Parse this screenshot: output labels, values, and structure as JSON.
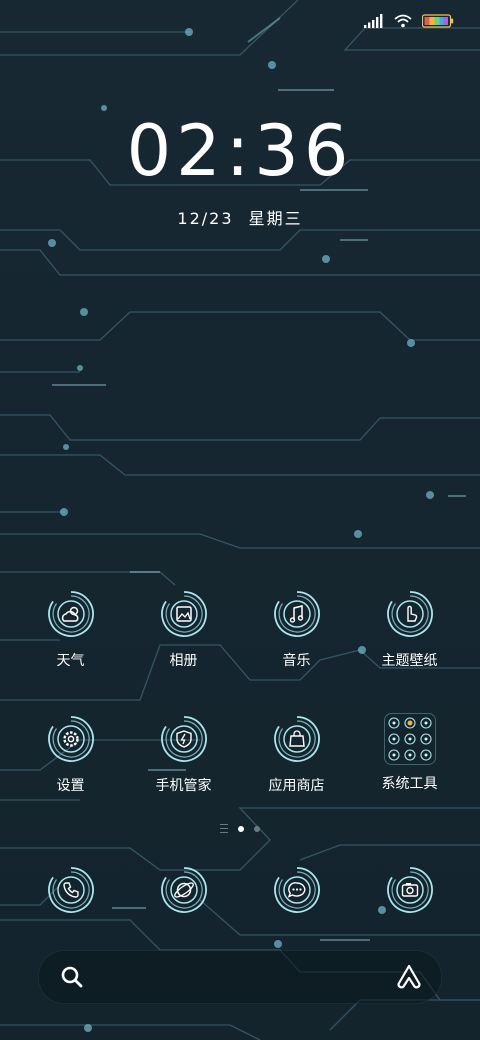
{
  "clock": {
    "time": "02:36"
  },
  "date": {
    "day": "12/23",
    "weekday": "星期三"
  },
  "apps_row1": [
    {
      "label": "天气",
      "icon": "weather-icon"
    },
    {
      "label": "相册",
      "icon": "gallery-icon"
    },
    {
      "label": "音乐",
      "icon": "music-icon"
    },
    {
      "label": "主题壁纸",
      "icon": "theme-icon"
    }
  ],
  "apps_row2": [
    {
      "label": "设置",
      "icon": "settings-icon"
    },
    {
      "label": "手机管家",
      "icon": "phone-manager-icon"
    },
    {
      "label": "应用商店",
      "icon": "app-store-icon"
    },
    {
      "label": "系统工具",
      "icon": "system-tools-folder-icon"
    }
  ],
  "dock": [
    {
      "icon": "phone-icon"
    },
    {
      "icon": "browser-icon"
    },
    {
      "icon": "messages-icon"
    },
    {
      "icon": "camera-icon"
    }
  ],
  "page_indicator": {
    "current_page": 1,
    "pages": 2
  },
  "colors": {
    "accent": "#a9e6ee",
    "background": "#16262f"
  }
}
